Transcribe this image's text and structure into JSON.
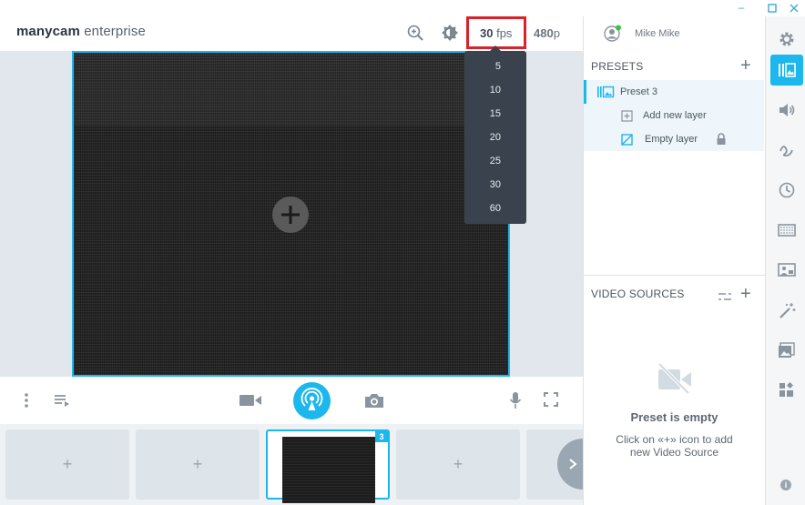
{
  "app": {
    "logo_bold": "manycam",
    "logo_light": " enterprise"
  },
  "window_controls": {
    "minimize_icon": "minimize-icon",
    "maximize_icon": "maximize-icon",
    "close_icon": "close-icon"
  },
  "header": {
    "fps_value": "30",
    "fps_unit": " fps",
    "resolution_value": "480",
    "resolution_unit": "p"
  },
  "user": {
    "name": "Mike Mike",
    "status_color": "#3cc23c"
  },
  "fps_dropdown": {
    "options": [
      "5",
      "10",
      "15",
      "20",
      "25",
      "30",
      "60"
    ]
  },
  "presets_panel": {
    "title": "PRESETS",
    "preset_name": "Preset 3",
    "add_layer_label": "Add new layer",
    "empty_layer_label": "Empty layer"
  },
  "video_sources_panel": {
    "title": "VIDEO SOURCES",
    "empty_title": "Preset is empty",
    "empty_line1": "Click on «+» icon to add",
    "empty_line2": "new Video Source"
  },
  "preset_strip": {
    "active_number": "3"
  },
  "colors": {
    "accent": "#1cb7ec",
    "highlight_box": "#d8232a",
    "dropdown_bg": "#3a434d"
  }
}
